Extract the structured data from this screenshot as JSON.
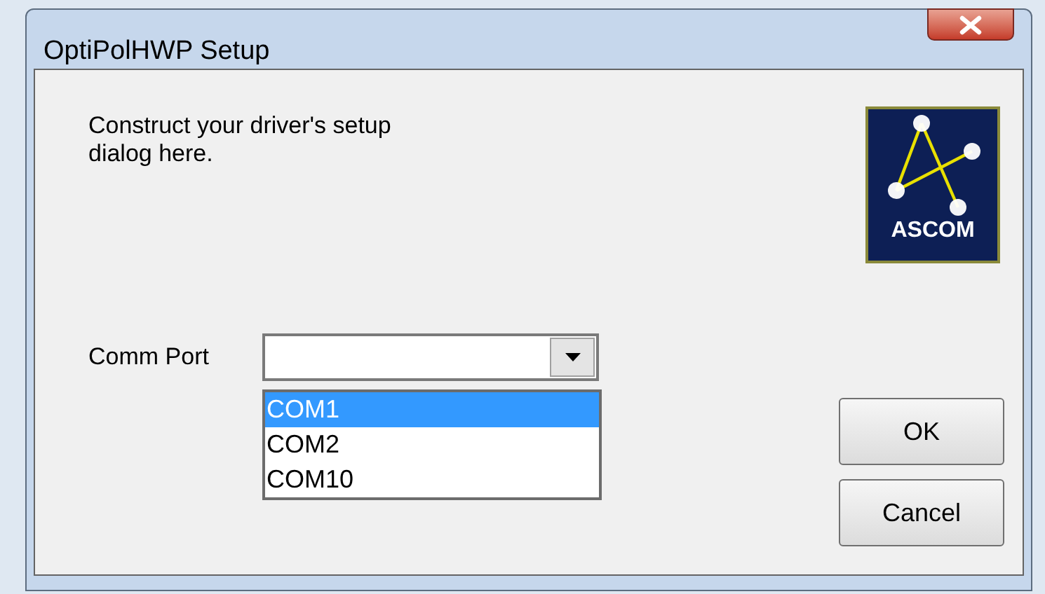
{
  "window": {
    "title": "OptiPolHWP Setup"
  },
  "description": "Construct your driver's setup dialog here.",
  "logo": {
    "text": "ASCOM"
  },
  "comm_port": {
    "label": "Comm Port",
    "expanded": true,
    "options": [
      {
        "label": "COM1",
        "selected": true
      },
      {
        "label": "COM2",
        "selected": false
      },
      {
        "label": "COM10",
        "selected": false
      }
    ]
  },
  "buttons": [
    {
      "label": "OK"
    },
    {
      "label": "Cancel"
    }
  ]
}
